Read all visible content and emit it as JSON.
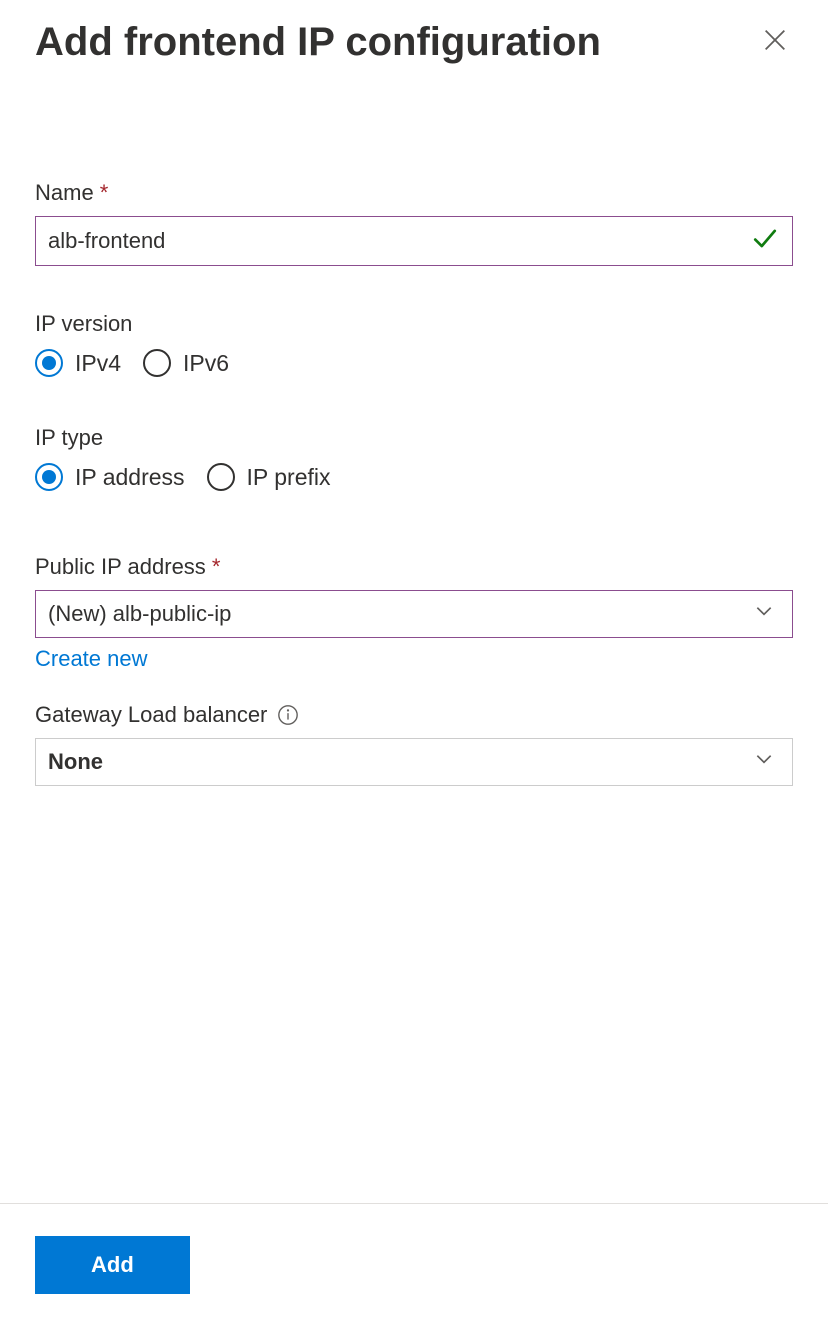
{
  "header": {
    "title": "Add frontend IP configuration"
  },
  "form": {
    "name": {
      "label": "Name",
      "value": "alb-frontend"
    },
    "ipVersion": {
      "label": "IP version",
      "options": [
        "IPv4",
        "IPv6"
      ],
      "selected": "IPv4"
    },
    "ipType": {
      "label": "IP type",
      "options": [
        "IP address",
        "IP prefix"
      ],
      "selected": "IP address"
    },
    "publicIp": {
      "label": "Public IP address",
      "value": "(New) alb-public-ip",
      "createNewLink": "Create new"
    },
    "gatewayLb": {
      "label": "Gateway Load balancer",
      "value": "None"
    }
  },
  "footer": {
    "addButton": "Add"
  }
}
